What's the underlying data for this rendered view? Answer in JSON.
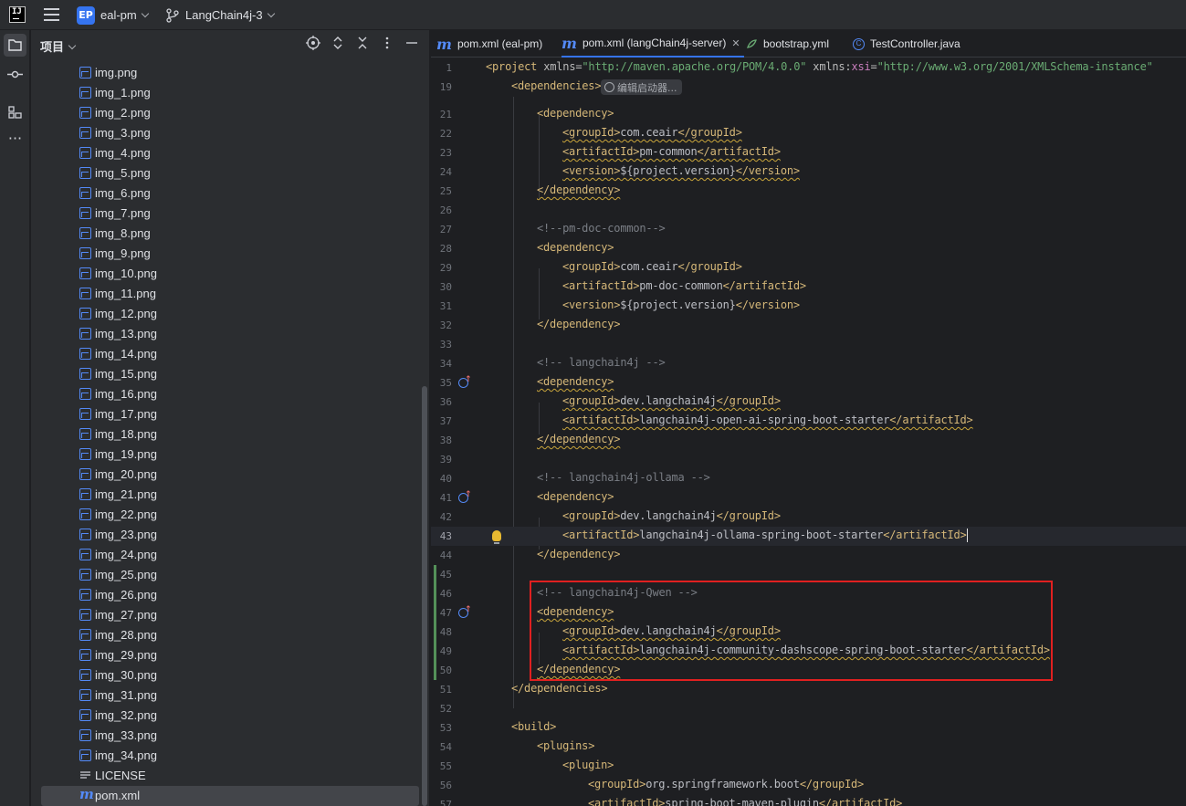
{
  "titlebar": {
    "project_badge": "EP",
    "project_name": "eal-pm",
    "branch_name": "LangChain4j-3"
  },
  "project_panel": {
    "title": "项目",
    "tools": [
      "target-icon",
      "expand-icon",
      "collapse-icon",
      "more-icon",
      "minimize-icon"
    ],
    "files": [
      "img.png",
      "img_1.png",
      "img_2.png",
      "img_3.png",
      "img_4.png",
      "img_5.png",
      "img_6.png",
      "img_7.png",
      "img_8.png",
      "img_9.png",
      "img_10.png",
      "img_11.png",
      "img_12.png",
      "img_13.png",
      "img_14.png",
      "img_15.png",
      "img_16.png",
      "img_17.png",
      "img_18.png",
      "img_19.png",
      "img_20.png",
      "img_21.png",
      "img_22.png",
      "img_23.png",
      "img_24.png",
      "img_25.png",
      "img_26.png",
      "img_27.png",
      "img_28.png",
      "img_29.png",
      "img_30.png",
      "img_31.png",
      "img_32.png",
      "img_33.png",
      "img_34.png"
    ],
    "license": "LICENSE",
    "pom": "pom.xml"
  },
  "tabs": [
    {
      "icon": "m",
      "label": "pom.xml (eal-pm)"
    },
    {
      "icon": "m",
      "label": "pom.xml (langChain4j-server)",
      "close": "✕"
    },
    {
      "icon": "yml",
      "label": "bootstrap.yml"
    },
    {
      "icon": "c",
      "label": "TestController.java"
    }
  ],
  "editor": {
    "hint": "编辑启动器...",
    "line_numbers": [
      "1",
      "19",
      "21",
      "22",
      "23",
      "24",
      "25",
      "26",
      "27",
      "28",
      "29",
      "30",
      "31",
      "32",
      "33",
      "34",
      "35",
      "36",
      "37",
      "38",
      "39",
      "40",
      "41",
      "42",
      "43",
      "44",
      "45",
      "46",
      "47",
      "48",
      "49",
      "50",
      "51",
      "52",
      "53",
      "54",
      "55",
      "56",
      "57"
    ],
    "lines": {
      "l1_tag": "<project ",
      "l1_attr1": "xmlns",
      "l1_eq": "=",
      "l1_val1": "\"http://maven.apache.org/POM/4.0.0\"",
      "l1_attr2": "xmlns",
      "l1_colon": ":",
      "l1_ns": "xsi",
      "l1_val2": "\"http://www.w3.org/2001/XMLSchema-instance\"",
      "l19": "<dependencies>",
      "dep_open": "<dependency>",
      "dep_close": "</dependency>",
      "gid_open": "<groupId>",
      "gid_close": "</groupId>",
      "aid_open": "<artifactId>",
      "aid_close": "</artifactId>",
      "ver_open": "<version>",
      "ver_close": "</version>",
      "ceair": "com.ceair",
      "pm_common": "pm-common",
      "project_version": "${project.version}",
      "c_pm_doc_common": "<!--pm-doc-common-->",
      "pm_doc_common": "pm-doc-common",
      "c_langchain4j": "<!-- langchain4j -->",
      "dev_langchain4j": "dev.langchain4j",
      "openai_starter": "langchain4j-open-ai-spring-boot-starter",
      "c_ollama": "<!-- langchain4j-ollama -->",
      "ollama_starter": "langchain4j-ollama-spring-boot-starter",
      "c_qwen": "<!-- langchain4j-Qwen -->",
      "dashscope_starter": "langchain4j-community-dashscope-spring-boot-starter",
      "deps_close": "</dependencies>",
      "build_open": "<build>",
      "plugins_open": "<plugins>",
      "plugin_open": "<plugin>",
      "springboot_gid": "org.springframework.boot",
      "maven_plugin": "spring-boot-maven-plugin"
    }
  },
  "colors": {
    "accent": "#3574f0",
    "highlight_box": "#e02020",
    "tag": "#d5b778",
    "string": "#6aab73",
    "comment": "#7a7e85"
  }
}
